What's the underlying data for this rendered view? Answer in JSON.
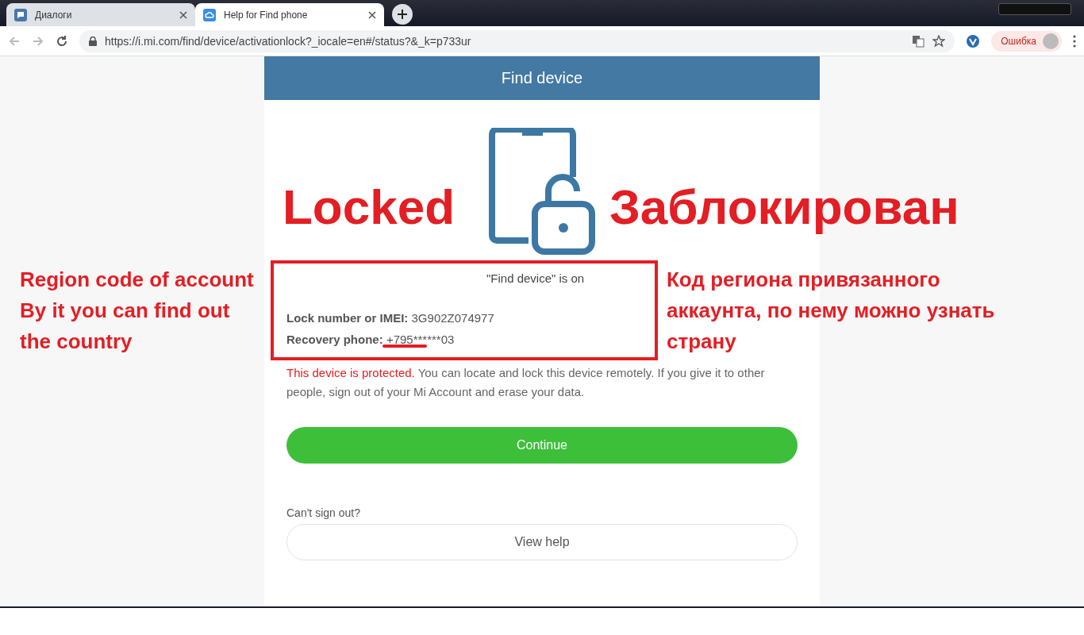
{
  "browser": {
    "tabs": [
      {
        "title": "Диалоги",
        "kind": "chat",
        "selected": false
      },
      {
        "title": "Help for Find phone",
        "kind": "cloud",
        "selected": true
      }
    ],
    "url": "https://i.mi.com/find/device/activationlock?_iocale=en#/status?&_k=p733ur",
    "profile_label": "Ошибка"
  },
  "page": {
    "header": "Find device",
    "status": "\"Find device\" is on",
    "fields": [
      {
        "label": "Lock number or IMEI:",
        "value": "3G902Z074977"
      },
      {
        "label": "Recovery phone:",
        "value": "+795******03"
      }
    ],
    "protected_notice": "This device is protected.",
    "notice": " You can locate and lock this device remotely. If you give it to other people, sign out of your Mi Account and erase your data.",
    "continue_button": "Continue",
    "cant_sign_out": "Can't sign out?",
    "view_help_button": "View help"
  },
  "annotations": {
    "locked_en": "Locked",
    "locked_ru": "Заблокирован",
    "region_en": [
      "Region code of account",
      "By it you can find out",
      "the country"
    ],
    "region_ru": [
      "Код региона привязанного",
      "аккаунта, по нему можно узнать",
      "страну"
    ]
  }
}
